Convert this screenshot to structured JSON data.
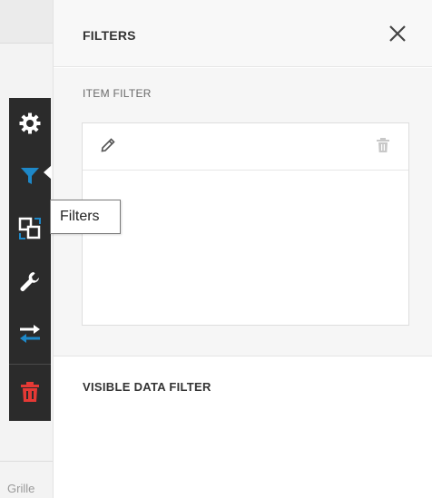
{
  "background": {
    "partial_text": "Grille"
  },
  "toolbar": {
    "items": [
      {
        "name": "settings",
        "icon": "gear-icon",
        "color": "#ffffff"
      },
      {
        "name": "filters",
        "icon": "filter-icon",
        "color": "#1e88c8",
        "active": true
      },
      {
        "name": "convert",
        "icon": "convert-icon",
        "color": "#ffffff"
      },
      {
        "name": "options",
        "icon": "wrench-icon",
        "color": "#ffffff"
      },
      {
        "name": "interactivity",
        "icon": "swap-arrows-icon",
        "color": "#ffffff"
      },
      {
        "name": "delete",
        "icon": "trash-icon",
        "color": "#e53935"
      }
    ]
  },
  "tooltip": {
    "text": "Filters"
  },
  "panel": {
    "title": "FILTERS",
    "item_filter_label": "ITEM FILTER",
    "visible_data_filter_label": "VISIBLE DATA FILTER"
  },
  "colors": {
    "toolbar_bg": "#2b2b2b",
    "accent_blue": "#1e88c8",
    "danger_red": "#e53935"
  }
}
